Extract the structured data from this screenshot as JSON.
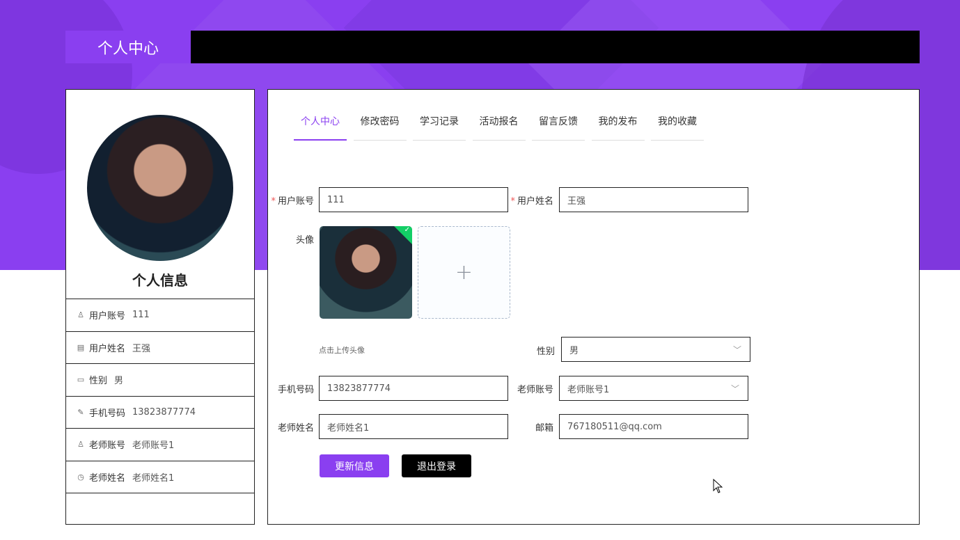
{
  "header": {
    "title": "个人中心"
  },
  "left": {
    "title": "个人信息",
    "items": [
      {
        "icon": "user-icon",
        "glyph": "♙",
        "label": "用户账号",
        "value": "111"
      },
      {
        "icon": "card-icon",
        "glyph": "▤",
        "label": "用户姓名",
        "value": "王强"
      },
      {
        "icon": "message-icon",
        "glyph": "▭",
        "label": "性别",
        "value": "男"
      },
      {
        "icon": "edit-icon",
        "glyph": "✎",
        "label": "手机号码",
        "value": "13823877774"
      },
      {
        "icon": "user-outline-icon",
        "glyph": "♙",
        "label": "老师账号",
        "value": "老师账号1"
      },
      {
        "icon": "clock-icon",
        "glyph": "◷",
        "label": "老师姓名",
        "value": "老师姓名1"
      }
    ]
  },
  "tabs": [
    {
      "label": "个人中心",
      "active": true
    },
    {
      "label": "修改密码",
      "active": false
    },
    {
      "label": "学习记录",
      "active": false
    },
    {
      "label": "活动报名",
      "active": false
    },
    {
      "label": "留言反馈",
      "active": false
    },
    {
      "label": "我的发布",
      "active": false
    },
    {
      "label": "我的收藏",
      "active": false
    }
  ],
  "form": {
    "required_mark": "*",
    "account_label": "用户账号",
    "account_value": "111",
    "name_label": "用户姓名",
    "name_value": "王强",
    "avatar_label": "头像",
    "upload_plus": "+",
    "upload_hint": "点击上传头像",
    "gender_label": "性别",
    "gender_value": "男",
    "phone_label": "手机号码",
    "phone_value": "13823877774",
    "teacher_account_label": "老师账号",
    "teacher_account_value": "老师账号1",
    "teacher_name_label": "老师姓名",
    "teacher_name_value": "老师姓名1",
    "email_label": "邮箱",
    "email_value": "767180511@qq.com",
    "update_button": "更新信息",
    "logout_button": "退出登录"
  },
  "colors": {
    "primary": "#8a3ff0",
    "success": "#13ce66",
    "dark": "#000000"
  }
}
